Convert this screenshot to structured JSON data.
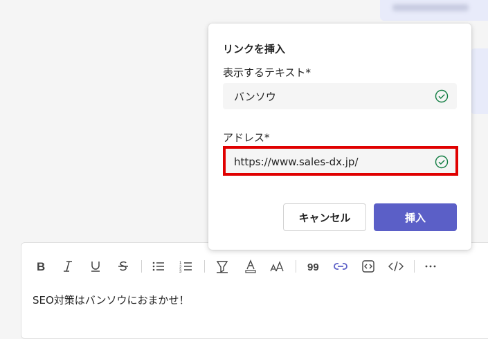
{
  "dialog": {
    "title": "リンクを挿入",
    "display_text_label": "表示するテキスト*",
    "display_text_value": "バンソウ",
    "address_label": "アドレス*",
    "address_value": "https://www.sales-dx.jp/",
    "cancel_label": "キャンセル",
    "insert_label": "挿入"
  },
  "composer": {
    "message_text": "SEO対策はバンソウにおまかせ！",
    "toolbar_icons": [
      "bold-icon",
      "italic-icon",
      "underline-icon",
      "strikethrough-icon",
      "bulleted-list-icon",
      "numbered-list-icon",
      "highlight-icon",
      "font-color-icon",
      "font-size-icon",
      "quote-icon",
      "link-icon",
      "code-snippet-icon",
      "code-icon",
      "more-options-icon"
    ]
  },
  "colors": {
    "accent": "#5b5fc7",
    "valid_check": "#107c41",
    "highlight_box": "#e00000"
  }
}
